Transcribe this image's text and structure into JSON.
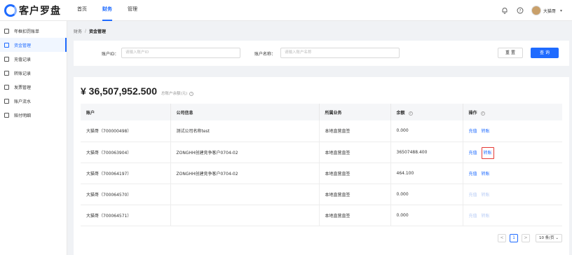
{
  "app": {
    "logo_text": "客户罗盘"
  },
  "nav": {
    "items": [
      "首页",
      "财务",
      "管理"
    ]
  },
  "user": {
    "name": "大猫哥"
  },
  "sidebar": {
    "items": [
      {
        "label": "年框扣罚账单",
        "icon": "document-icon"
      },
      {
        "label": "资金管理",
        "icon": "folder-icon"
      },
      {
        "label": "充值记录",
        "icon": "list-icon"
      },
      {
        "label": "转账记录",
        "icon": "transfer-icon"
      },
      {
        "label": "发票管理",
        "icon": "invoice-icon"
      },
      {
        "label": "账户流水",
        "icon": "flow-icon"
      },
      {
        "label": "赔付明细",
        "icon": "detail-icon"
      }
    ]
  },
  "breadcrumb": {
    "parent": "财务",
    "separator": "/",
    "current": "资金管理"
  },
  "search": {
    "account_id_label": "账户ID：",
    "account_id_placeholder": "请输入账户ID",
    "account_name_label": "账户名称：",
    "account_name_placeholder": "请输入账户名称",
    "reset_label": "重 置",
    "query_label": "查 询"
  },
  "summary": {
    "total": "¥ 36,507,952.500",
    "note": "总账户余额(元)"
  },
  "table": {
    "headers": [
      "账户",
      "公司信息",
      "所属业务",
      "余额",
      "操作"
    ],
    "rows": [
      {
        "account": "大猫哥（700000498）",
        "company": "测试公司名称test",
        "business": "本地直营直签",
        "balance": "0.000",
        "recharge": "充值",
        "transfer": "转账",
        "enabled": true,
        "highlight": false
      },
      {
        "account": "大猫哥（700063904）",
        "company": "ZONGHH创建竞争客户0704-02",
        "business": "本地直营直签",
        "balance": "36507488.400",
        "recharge": "充值",
        "transfer": "转账",
        "enabled": true,
        "highlight": true
      },
      {
        "account": "大猫哥（700064197）",
        "company": "ZONGHH创建竞争客户0704-02",
        "business": "本地直营直签",
        "balance": "464.100",
        "recharge": "充值",
        "transfer": "转账",
        "enabled": true,
        "highlight": false
      },
      {
        "account": "大猫哥（700064570）",
        "company": "",
        "business": "本地直营直签",
        "balance": "0.000",
        "recharge": "充值",
        "transfer": "转账",
        "enabled": false,
        "highlight": false
      },
      {
        "account": "大猫哥（700064571）",
        "company": "",
        "business": "本地直营直签",
        "balance": "0.000",
        "recharge": "充值",
        "transfer": "转账",
        "enabled": false,
        "highlight": false
      }
    ]
  },
  "pagination": {
    "prev": "<",
    "current_page": "1",
    "next": ">",
    "page_size": "10 条/页"
  },
  "colors": {
    "primary": "#1f6bff",
    "highlight_border": "#e53935"
  }
}
